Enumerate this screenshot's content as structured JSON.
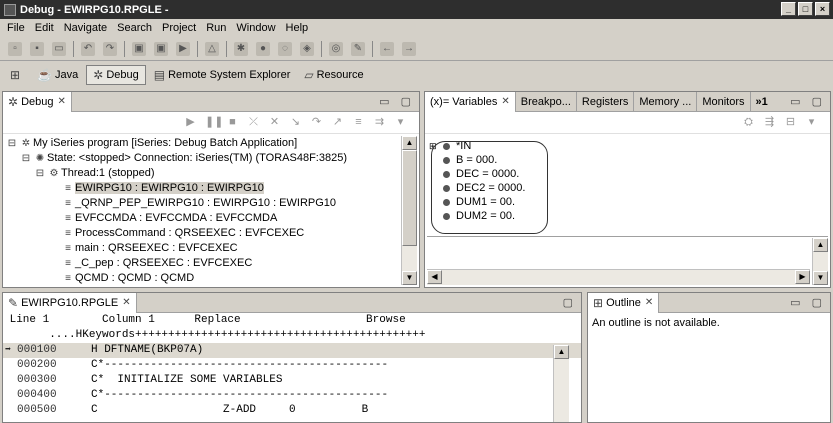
{
  "window": {
    "title": "Debug - EWIRPG10.RPGLE -"
  },
  "menu": [
    "File",
    "Edit",
    "Navigate",
    "Search",
    "Project",
    "Run",
    "Window",
    "Help"
  ],
  "perspectives": [
    {
      "label": "Java",
      "icon": "java-icon"
    },
    {
      "label": "Debug",
      "icon": "debug-bug-icon",
      "active": true
    },
    {
      "label": "Remote System Explorer",
      "icon": "rse-icon"
    },
    {
      "label": "Resource",
      "icon": "resource-icon"
    }
  ],
  "debug_view": {
    "tab": "Debug",
    "tree": [
      "My iSeries program [iSeries: Debug Batch Application]",
      "State: <stopped> Connection: iSeries(TM) (TORAS48F:3825)",
      "Thread:1 (stopped)",
      "EWIRPG10 : EWIRPG10 : EWIRPG10",
      "_QRNP_PEP_EWIRPG10 : EWIRPG10 : EWIRPG10",
      "EVFCCMDA : EVFCCMDA : EVFCCMDA",
      "ProcessCommand : QRSEEXEC : EVFCEXEC",
      "main : QRSEEXEC : EVFCEXEC",
      "_C_pep : QRSEEXEC : EVFCEXEC",
      "QCMD : QCMD : QCMD"
    ]
  },
  "variables_view": {
    "tabs": [
      "(x)= Variables",
      "Breakpo...",
      "Registers",
      "Memory ...",
      "Monitors",
      "»1"
    ],
    "items": [
      "*IN",
      "B = 000.",
      "DEC = 0000.",
      "DEC2 = 0000.",
      "DUM1 = 00.",
      "DUM2 = 00."
    ]
  },
  "editor": {
    "tab": "EWIRPG10.RPGLE",
    "ruler": " Line 1        Column 1      Replace                   Browse",
    "keywords_line": "       ....HKeywords++++++++++++++++++++++++++++++++++++++++++++",
    "lines": [
      {
        "num": "000100",
        "text": "H DFTNAME(BKP07A)",
        "current": true
      },
      {
        "num": "000200",
        "text": "C*-------------------------------------------"
      },
      {
        "num": "000300",
        "text": "C*  INITIALIZE SOME VARIABLES"
      },
      {
        "num": "000400",
        "text": "C*-------------------------------------------"
      },
      {
        "num": "000500",
        "text": "C                   Z-ADD     0          B"
      }
    ]
  },
  "outline_view": {
    "tab": "Outline",
    "message": "An outline is not available."
  }
}
